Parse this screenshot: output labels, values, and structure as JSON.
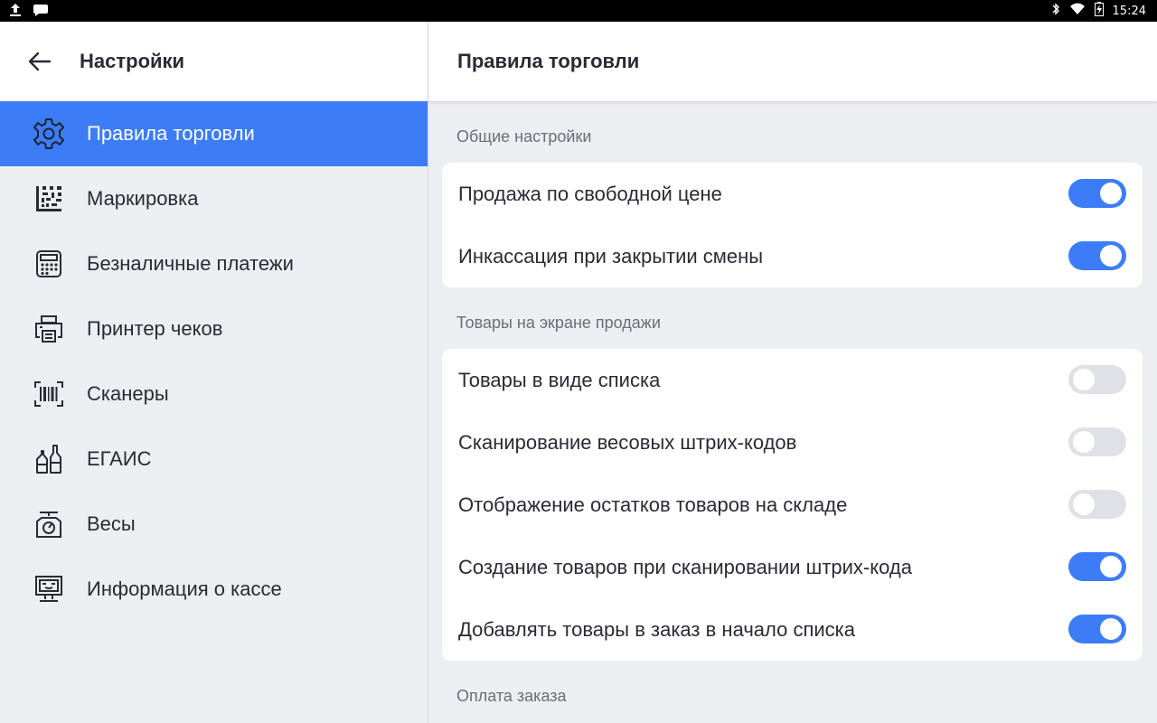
{
  "status_bar": {
    "time": "15:24",
    "icons": [
      "upload-icon",
      "message-icon",
      "bluetooth-icon",
      "wifi-icon",
      "battery-charging-icon"
    ]
  },
  "sidebar": {
    "title": "Настройки",
    "back_icon": "arrow-left-icon",
    "items": [
      {
        "label": "Правила торговли",
        "icon": "gear-icon",
        "active": true
      },
      {
        "label": "Маркировка",
        "icon": "datamatrix-icon",
        "active": false
      },
      {
        "label": "Безналичные платежи",
        "icon": "payment-terminal-icon",
        "active": false
      },
      {
        "label": "Принтер чеков",
        "icon": "printer-icon",
        "active": false
      },
      {
        "label": "Сканеры",
        "icon": "barcode-scanner-icon",
        "active": false
      },
      {
        "label": "ЕГАИС",
        "icon": "bottles-icon",
        "active": false
      },
      {
        "label": "Весы",
        "icon": "scales-icon",
        "active": false
      },
      {
        "label": "Информация о кассе",
        "icon": "pos-terminal-icon",
        "active": false
      }
    ]
  },
  "main": {
    "title": "Правила торговли",
    "sections": [
      {
        "title": "Общие настройки",
        "rows": [
          {
            "label": "Продажа по свободной цене",
            "enabled": true
          },
          {
            "label": "Инкассация при закрытии смены",
            "enabled": true
          }
        ]
      },
      {
        "title": "Товары на экране продажи",
        "rows": [
          {
            "label": "Товары в виде списка",
            "enabled": false
          },
          {
            "label": "Сканирование весовых штрих-кодов",
            "enabled": false
          },
          {
            "label": "Отображение остатков товаров на складе",
            "enabled": false
          },
          {
            "label": "Создание товаров при сканировании штрих-кода",
            "enabled": true
          },
          {
            "label": "Добавлять товары в заказ в начало списка",
            "enabled": true
          }
        ]
      },
      {
        "title": "Оплата заказа",
        "rows": []
      }
    ]
  },
  "colors": {
    "accent": "#3c7df7",
    "background": "#eceef1",
    "card": "#ffffff",
    "text": "#2b2a35",
    "muted": "#6e6c78",
    "toggle_off": "#dfe1e6"
  }
}
